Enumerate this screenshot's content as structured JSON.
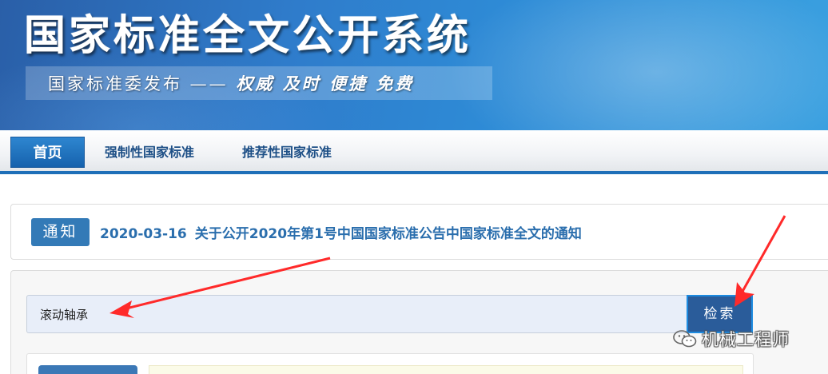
{
  "header": {
    "site_title": "国家标准全文公开系统",
    "slogan_left": "国家标准委发布 ——",
    "slogan_right": "权威 及时 便捷 免费"
  },
  "nav": {
    "items": [
      {
        "label": "首页",
        "active": true
      },
      {
        "label": "强制性国家标准",
        "active": false
      },
      {
        "label": "推荐性国家标准",
        "active": false
      }
    ]
  },
  "notice": {
    "badge": "通知",
    "date": "2020-03-16",
    "title": "关于公开2020年第1号中国国家标准公告中国家标准全文的通知"
  },
  "search": {
    "value": "滚动轴承",
    "button_label": "检索"
  },
  "watermark": {
    "text": "机械工程师"
  },
  "colors": {
    "nav_active": "#1f6fb8",
    "link": "#2a6ead",
    "search_button": "#2a5c9a",
    "annotation_arrow": "#ff2a2a"
  }
}
